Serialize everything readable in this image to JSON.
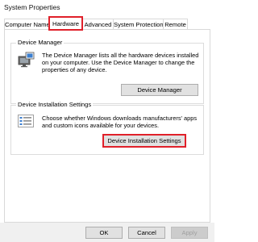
{
  "window": {
    "title": "System Properties"
  },
  "tabs": [
    {
      "label": "Computer Name",
      "active": false
    },
    {
      "label": "Hardware",
      "active": true
    },
    {
      "label": "Advanced",
      "active": false
    },
    {
      "label": "System Protection",
      "active": false
    },
    {
      "label": "Remote",
      "active": false
    }
  ],
  "device_manager": {
    "group_label": "Device Manager",
    "description": "The Device Manager lists all the hardware devices installed on your computer. Use the Device Manager to change the properties of any device.",
    "button_label": "Device Manager",
    "icon": "device-manager-icon"
  },
  "device_installation": {
    "group_label": "Device Installation Settings",
    "description": "Choose whether Windows downloads manufacturers' apps and custom icons available for your devices.",
    "button_label": "Device Installation Settings",
    "icon": "settings-list-icon"
  },
  "footer": {
    "ok_label": "OK",
    "cancel_label": "Cancel",
    "apply_label": "Apply"
  },
  "colors": {
    "highlight": "#e0202a",
    "button_face": "#e1e1e1",
    "footer_bg": "#f0f0f0"
  }
}
